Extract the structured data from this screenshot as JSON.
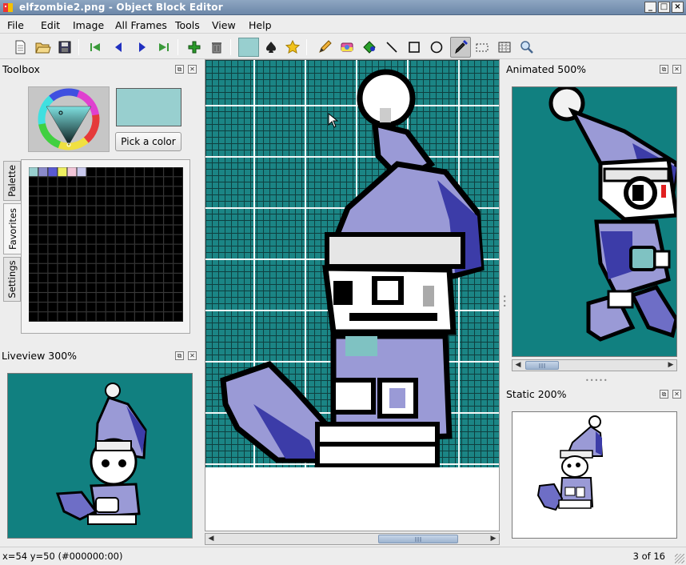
{
  "window": {
    "title": "elfzombie2.png - Object Block Editor",
    "controls": [
      "_",
      "□",
      "×"
    ]
  },
  "menu": [
    "File",
    "Edit",
    "Image",
    "All Frames",
    "Tools",
    "View",
    "Help"
  ],
  "toolbar": {
    "icons": [
      "new-file-icon",
      "open-folder-icon",
      "save-icon",
      "first-frame-icon",
      "previous-frame-icon",
      "next-frame-icon",
      "last-frame-icon",
      "add-frame-icon",
      "delete-frame-icon",
      "current-color-swatch",
      "spade-stamp-icon",
      "star-stamp-icon",
      "pencil-icon",
      "eraser-icon",
      "fill-icon",
      "line-icon",
      "rectangle-icon",
      "ellipse-icon",
      "color-picker-icon",
      "selection-icon",
      "grid-icon",
      "zoom-icon"
    ],
    "active_tool": "color-picker-icon",
    "current_color": "#98cfcf"
  },
  "toolbox": {
    "title": "Toolbox",
    "pick_color_label": "Pick a color",
    "selected_color": "#98cfcf",
    "tabs": [
      "Palette",
      "Favorites",
      "Settings"
    ],
    "active_tab": "Favorites",
    "favorite_colors": [
      "#98cfcf",
      "#8a8acb",
      "#5a5ad2",
      "#f0f060",
      "#f3c6d9",
      "#c9c9ee"
    ]
  },
  "liveview": {
    "title": "Liveview 300%"
  },
  "animated": {
    "title": "Animated 500%"
  },
  "static": {
    "title": "Static 200%"
  },
  "canvas": {
    "background": "#1b8585"
  },
  "status": {
    "cursor_info": "x=54 y=50 (#000000:00)",
    "frame_info": "3 of 16"
  },
  "colors": {
    "sprite_teal": "#118080",
    "hat_purple": "#9a9ad6",
    "hat_dark": "#3c3ca8",
    "pompom": "#f2f2f2"
  }
}
